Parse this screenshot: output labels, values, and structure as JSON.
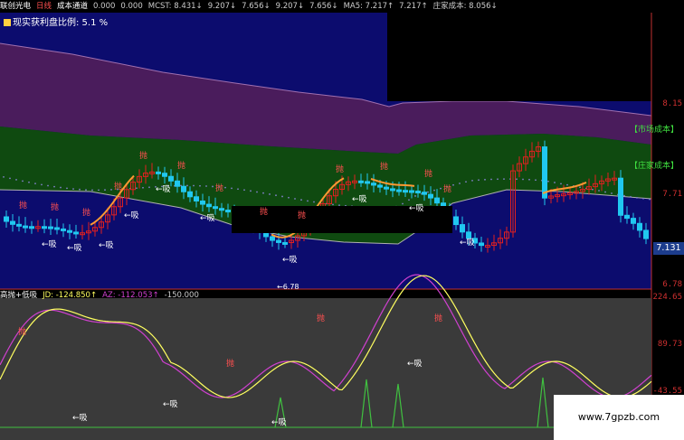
{
  "header": {
    "stock_name": "联创光电",
    "period": "日线",
    "indicator": "成本通道",
    "values": [
      "0.000",
      "0.000",
      "MCST: 8.431↓",
      "9.207↓",
      "7.656↓",
      "9.207↓",
      "7.656↓",
      "MA5: 7.217↑",
      "7.217↑",
      "庄家成本: 8.056↓"
    ]
  },
  "main": {
    "profit_text": "现实获利盘比例: 5.1 %",
    "band_labels": {
      "market": "【市场成本】",
      "banker": "【庄家成本】"
    },
    "y_axis": [
      "8.15",
      "7.71",
      "6.78"
    ],
    "current_price": "7.131",
    "low_marker": "6.78",
    "sell_label": "抛",
    "buy_label": "←吸"
  },
  "lower": {
    "header_title": "高抛+低吸",
    "jd": "JD: -124.850↑",
    "az": "AZ: -112.053↑",
    "level": "-150.000",
    "y_axis": [
      "224.65",
      "89.73",
      "-43.55"
    ]
  },
  "watermark": "www.7gpzb.com",
  "colors": {
    "bg": "#000000",
    "purple_band": "#4a1c5c",
    "green_band": "#0f4a10",
    "blue_bg": "#0c0c6e",
    "up": "#e02020",
    "down": "#20c8f0",
    "ma": "#ff9933",
    "dotted": "#8080c8",
    "jd": "#ffff60",
    "az": "#d040d0",
    "green_spike": "#40c040"
  }
}
